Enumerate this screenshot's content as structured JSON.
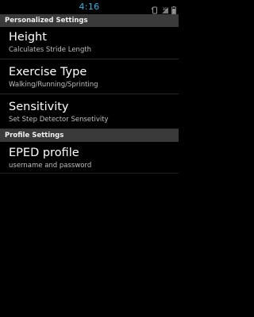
{
  "status_bar": {
    "time": "4:16",
    "icons": [
      "rotation-lock-icon",
      "signal-strength-icon",
      "battery-icon"
    ]
  },
  "sections": [
    {
      "header": "Personalized Settings",
      "items": [
        {
          "title": "Height",
          "summary": "Calculates Stride Length"
        },
        {
          "title": "Exercise Type",
          "summary": "Walking/Running/Sprinting"
        },
        {
          "title": "Sensitivity",
          "summary": "Set Step Detector Sensetivity"
        }
      ]
    },
    {
      "header": "Profile Settings",
      "items": [
        {
          "title": "EPED profile",
          "summary": "username and password"
        }
      ]
    }
  ],
  "colors": {
    "accent": "#33b5e5",
    "header_bg": "#3a3a3a",
    "background": "#000000"
  }
}
